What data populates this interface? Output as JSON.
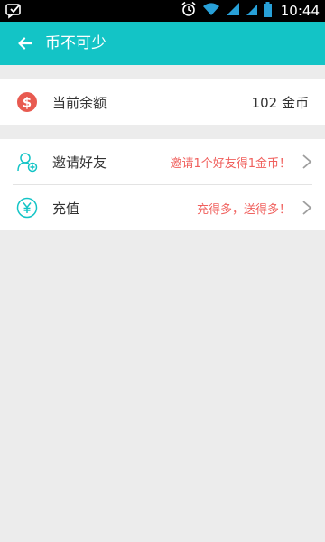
{
  "status_bar": {
    "time": "10:44"
  },
  "toolbar": {
    "title": "币不可少"
  },
  "balance": {
    "label": "当前余额",
    "value": "102 金币"
  },
  "invite": {
    "label": "邀请好友",
    "hint": "邀请1个好友得1金币！"
  },
  "recharge": {
    "label": "充值",
    "hint": "充得多，送得多！"
  },
  "colors": {
    "accent": "#13c4c6",
    "hint": "#f0605d",
    "coin": "#e85a50",
    "background": "#ececec"
  }
}
